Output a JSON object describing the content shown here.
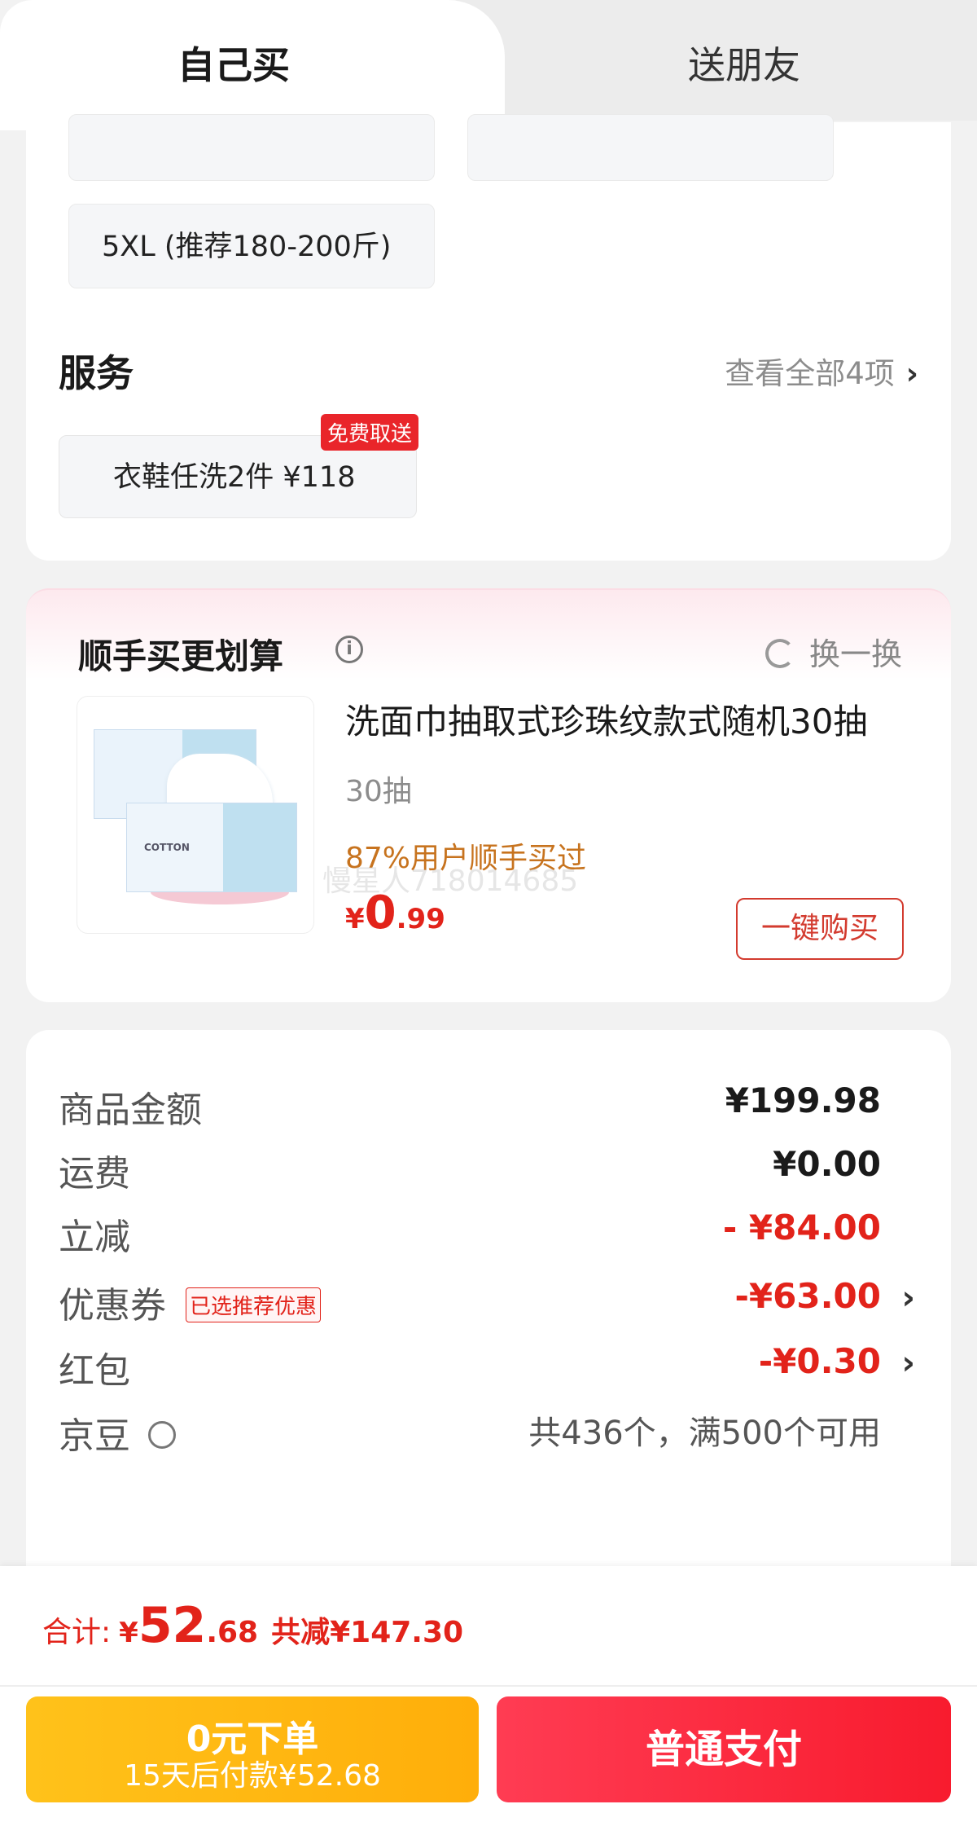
{
  "tabs": {
    "self": "自己买",
    "friend": "送朋友"
  },
  "sizes": {
    "visible_full": "5XL (推荐180-200斤)"
  },
  "service": {
    "title": "服务",
    "view_all": "查看全部4项",
    "chip_label": "衣鞋任洗2件  ¥118",
    "chip_badge": "免费取送"
  },
  "recommend": {
    "title": "顺手买更划算",
    "swap_label": "换一换",
    "product": {
      "name": "洗面巾抽取式珍珠纹款式随机30抽",
      "spec": "30抽",
      "popularity": "87%用户顺手买过",
      "price_currency": "¥",
      "price_int": "0",
      "price_dec": ".99",
      "buy_label": "一键购买",
      "package_text": "COTTON",
      "watermark": "慢星人718014685"
    }
  },
  "summary": {
    "rows": [
      {
        "label": "商品金额",
        "value": "¥199.98"
      },
      {
        "label": "运费",
        "value": "¥0.00"
      },
      {
        "label": "立减",
        "value": "- ¥84.00"
      },
      {
        "label": "优惠券",
        "tag": "已选推荐优惠",
        "value": "-¥63.00"
      },
      {
        "label": "红包",
        "value": "-¥0.30"
      },
      {
        "label": "京豆",
        "value": "共436个，满500个可用"
      }
    ]
  },
  "footer": {
    "total_label": "合计:",
    "total_currency": "¥",
    "total_int": "52",
    "total_dec": ".68",
    "total_saving": "共减¥147.30",
    "zero_btn_line1": "0元下单",
    "zero_btn_line2": "15天后付款¥52.68",
    "pay_btn": "普通支付"
  },
  "colors": {
    "price_red": "#e2231a",
    "pay_btn": "#f8233a",
    "zero_btn": "#ffb812",
    "popularity": "#c7731e"
  }
}
